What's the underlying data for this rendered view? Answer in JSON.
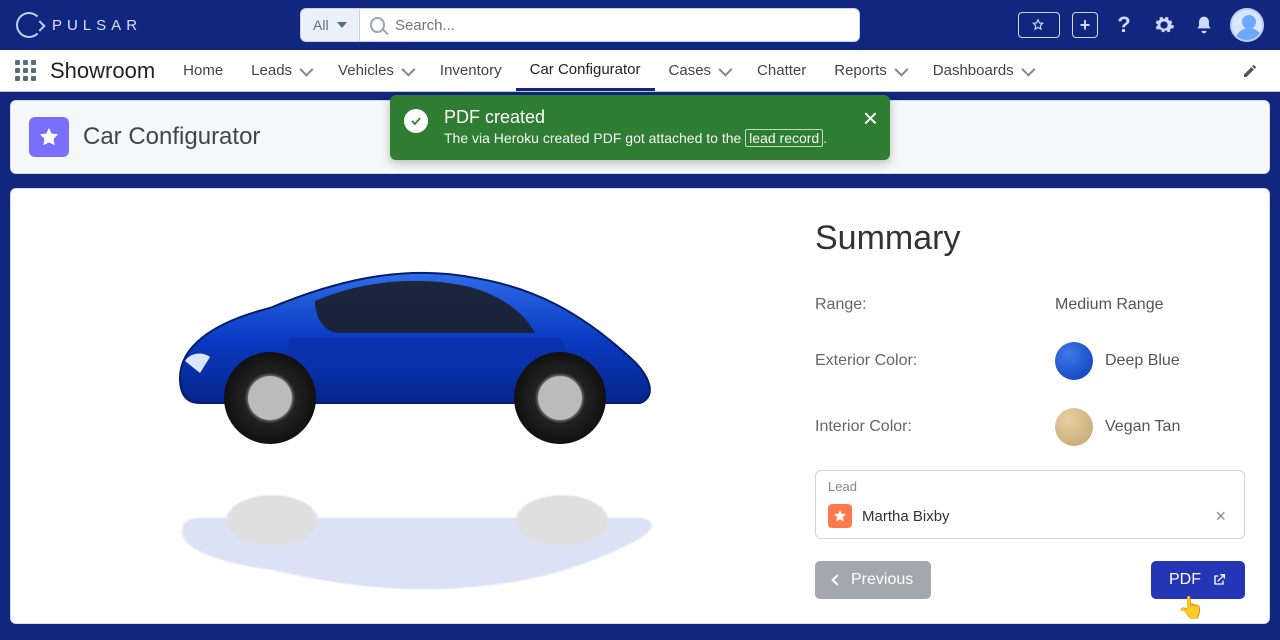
{
  "brand": {
    "name": "PULSAR"
  },
  "search": {
    "scope": "All",
    "placeholder": "Search..."
  },
  "nav": {
    "app": "Showroom",
    "items": [
      {
        "label": "Home",
        "dropdown": false
      },
      {
        "label": "Leads",
        "dropdown": true
      },
      {
        "label": "Vehicles",
        "dropdown": true
      },
      {
        "label": "Inventory",
        "dropdown": false
      },
      {
        "label": "Car Configurator",
        "dropdown": false
      },
      {
        "label": "Cases",
        "dropdown": true
      },
      {
        "label": "Chatter",
        "dropdown": false
      },
      {
        "label": "Reports",
        "dropdown": true
      },
      {
        "label": "Dashboards",
        "dropdown": true
      }
    ],
    "active_index": 4
  },
  "page": {
    "title": "Car Configurator"
  },
  "toast": {
    "title": "PDF created",
    "body_prefix": "The via Heroku created PDF got attached to the ",
    "link_text": "lead record",
    "body_suffix": "."
  },
  "summary": {
    "title": "Summary",
    "range_label": "Range:",
    "range_value": "Medium Range",
    "exterior_label": "Exterior Color:",
    "exterior_value": "Deep Blue",
    "interior_label": "Interior Color:",
    "interior_value": "Vegan Tan",
    "lead_label": "Lead",
    "lead_name": "Martha Bixby",
    "prev_label": "Previous",
    "pdf_label": "PDF"
  },
  "colors": {
    "exterior_swatch": "#0b3ab8",
    "interior_swatch": "#c2a56d"
  }
}
